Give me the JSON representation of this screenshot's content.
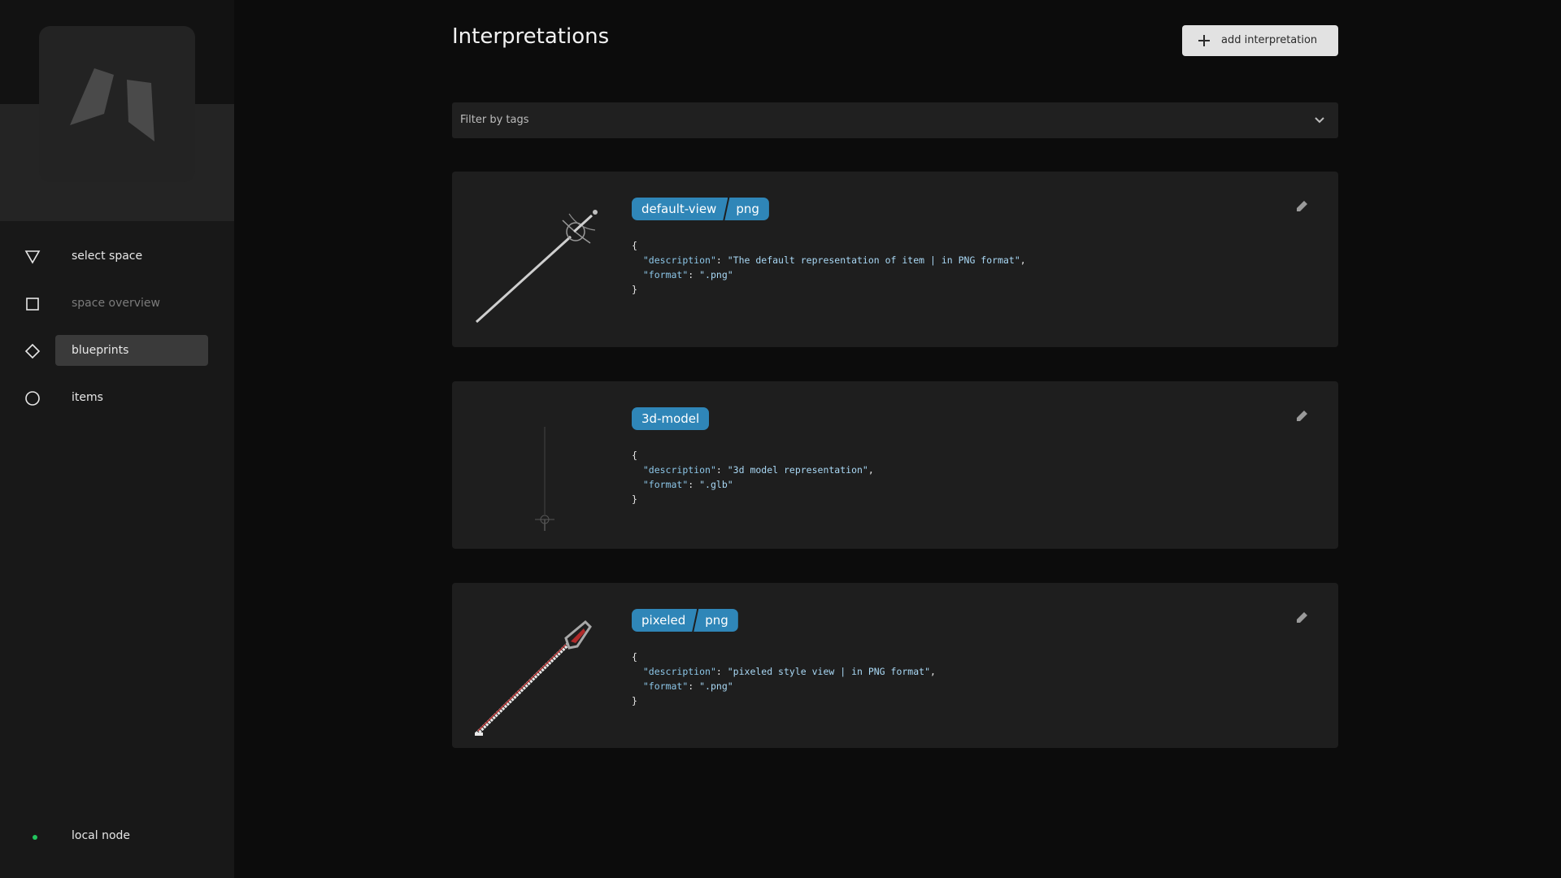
{
  "sidebar": {
    "nav": [
      {
        "label": "select space",
        "icon": "triangle-down-icon",
        "state": "normal"
      },
      {
        "label": "space overview",
        "icon": "square-icon",
        "state": "disabled"
      },
      {
        "label": "blueprints",
        "icon": "diamond-icon",
        "state": "active"
      },
      {
        "label": "items",
        "icon": "circle-icon",
        "state": "normal"
      }
    ],
    "node": {
      "label": "local node",
      "status_color": "#22c55e"
    }
  },
  "main": {
    "title": "Interpretations",
    "add_button_label": "add interpretation",
    "filter_placeholder": "Filter by tags",
    "cards": [
      {
        "tags": [
          "default-view",
          "png"
        ],
        "description": "The default representation of item | in PNG format",
        "format": ".png",
        "thumbnail": "rapier-sword-image"
      },
      {
        "tags": [
          "3d-model"
        ],
        "description": "3d model representation",
        "format": ".glb",
        "thumbnail": "rapier-3d-model-preview"
      },
      {
        "tags": [
          "pixeled",
          "png"
        ],
        "description": "pixeled style view | in PNG format",
        "format": ".png",
        "thumbnail": "pixel-rapier-image"
      }
    ]
  },
  "colors": {
    "accent": "#2f86b8",
    "background": "#0c0c0c",
    "card": "#1e1e1e"
  }
}
